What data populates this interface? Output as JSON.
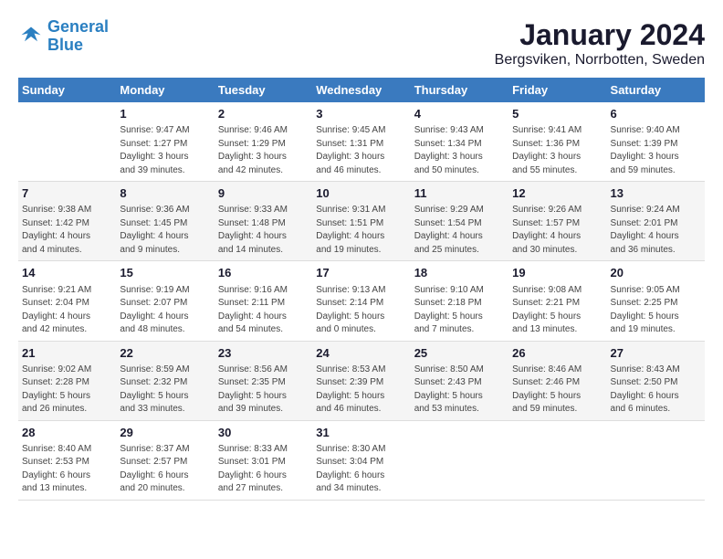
{
  "header": {
    "logo_line1": "General",
    "logo_line2": "Blue",
    "main_title": "January 2024",
    "subtitle": "Bergsviken, Norrbotten, Sweden"
  },
  "calendar": {
    "weekdays": [
      "Sunday",
      "Monday",
      "Tuesday",
      "Wednesday",
      "Thursday",
      "Friday",
      "Saturday"
    ],
    "weeks": [
      {
        "days": [
          {
            "num": "",
            "info": ""
          },
          {
            "num": "1",
            "info": "Sunrise: 9:47 AM\nSunset: 1:27 PM\nDaylight: 3 hours\nand 39 minutes."
          },
          {
            "num": "2",
            "info": "Sunrise: 9:46 AM\nSunset: 1:29 PM\nDaylight: 3 hours\nand 42 minutes."
          },
          {
            "num": "3",
            "info": "Sunrise: 9:45 AM\nSunset: 1:31 PM\nDaylight: 3 hours\nand 46 minutes."
          },
          {
            "num": "4",
            "info": "Sunrise: 9:43 AM\nSunset: 1:34 PM\nDaylight: 3 hours\nand 50 minutes."
          },
          {
            "num": "5",
            "info": "Sunrise: 9:41 AM\nSunset: 1:36 PM\nDaylight: 3 hours\nand 55 minutes."
          },
          {
            "num": "6",
            "info": "Sunrise: 9:40 AM\nSunset: 1:39 PM\nDaylight: 3 hours\nand 59 minutes."
          }
        ]
      },
      {
        "days": [
          {
            "num": "7",
            "info": "Sunrise: 9:38 AM\nSunset: 1:42 PM\nDaylight: 4 hours\nand 4 minutes."
          },
          {
            "num": "8",
            "info": "Sunrise: 9:36 AM\nSunset: 1:45 PM\nDaylight: 4 hours\nand 9 minutes."
          },
          {
            "num": "9",
            "info": "Sunrise: 9:33 AM\nSunset: 1:48 PM\nDaylight: 4 hours\nand 14 minutes."
          },
          {
            "num": "10",
            "info": "Sunrise: 9:31 AM\nSunset: 1:51 PM\nDaylight: 4 hours\nand 19 minutes."
          },
          {
            "num": "11",
            "info": "Sunrise: 9:29 AM\nSunset: 1:54 PM\nDaylight: 4 hours\nand 25 minutes."
          },
          {
            "num": "12",
            "info": "Sunrise: 9:26 AM\nSunset: 1:57 PM\nDaylight: 4 hours\nand 30 minutes."
          },
          {
            "num": "13",
            "info": "Sunrise: 9:24 AM\nSunset: 2:01 PM\nDaylight: 4 hours\nand 36 minutes."
          }
        ]
      },
      {
        "days": [
          {
            "num": "14",
            "info": "Sunrise: 9:21 AM\nSunset: 2:04 PM\nDaylight: 4 hours\nand 42 minutes."
          },
          {
            "num": "15",
            "info": "Sunrise: 9:19 AM\nSunset: 2:07 PM\nDaylight: 4 hours\nand 48 minutes."
          },
          {
            "num": "16",
            "info": "Sunrise: 9:16 AM\nSunset: 2:11 PM\nDaylight: 4 hours\nand 54 minutes."
          },
          {
            "num": "17",
            "info": "Sunrise: 9:13 AM\nSunset: 2:14 PM\nDaylight: 5 hours\nand 0 minutes."
          },
          {
            "num": "18",
            "info": "Sunrise: 9:10 AM\nSunset: 2:18 PM\nDaylight: 5 hours\nand 7 minutes."
          },
          {
            "num": "19",
            "info": "Sunrise: 9:08 AM\nSunset: 2:21 PM\nDaylight: 5 hours\nand 13 minutes."
          },
          {
            "num": "20",
            "info": "Sunrise: 9:05 AM\nSunset: 2:25 PM\nDaylight: 5 hours\nand 19 minutes."
          }
        ]
      },
      {
        "days": [
          {
            "num": "21",
            "info": "Sunrise: 9:02 AM\nSunset: 2:28 PM\nDaylight: 5 hours\nand 26 minutes."
          },
          {
            "num": "22",
            "info": "Sunrise: 8:59 AM\nSunset: 2:32 PM\nDaylight: 5 hours\nand 33 minutes."
          },
          {
            "num": "23",
            "info": "Sunrise: 8:56 AM\nSunset: 2:35 PM\nDaylight: 5 hours\nand 39 minutes."
          },
          {
            "num": "24",
            "info": "Sunrise: 8:53 AM\nSunset: 2:39 PM\nDaylight: 5 hours\nand 46 minutes."
          },
          {
            "num": "25",
            "info": "Sunrise: 8:50 AM\nSunset: 2:43 PM\nDaylight: 5 hours\nand 53 minutes."
          },
          {
            "num": "26",
            "info": "Sunrise: 8:46 AM\nSunset: 2:46 PM\nDaylight: 5 hours\nand 59 minutes."
          },
          {
            "num": "27",
            "info": "Sunrise: 8:43 AM\nSunset: 2:50 PM\nDaylight: 6 hours\nand 6 minutes."
          }
        ]
      },
      {
        "days": [
          {
            "num": "28",
            "info": "Sunrise: 8:40 AM\nSunset: 2:53 PM\nDaylight: 6 hours\nand 13 minutes."
          },
          {
            "num": "29",
            "info": "Sunrise: 8:37 AM\nSunset: 2:57 PM\nDaylight: 6 hours\nand 20 minutes."
          },
          {
            "num": "30",
            "info": "Sunrise: 8:33 AM\nSunset: 3:01 PM\nDaylight: 6 hours\nand 27 minutes."
          },
          {
            "num": "31",
            "info": "Sunrise: 8:30 AM\nSunset: 3:04 PM\nDaylight: 6 hours\nand 34 minutes."
          },
          {
            "num": "",
            "info": ""
          },
          {
            "num": "",
            "info": ""
          },
          {
            "num": "",
            "info": ""
          }
        ]
      }
    ]
  }
}
